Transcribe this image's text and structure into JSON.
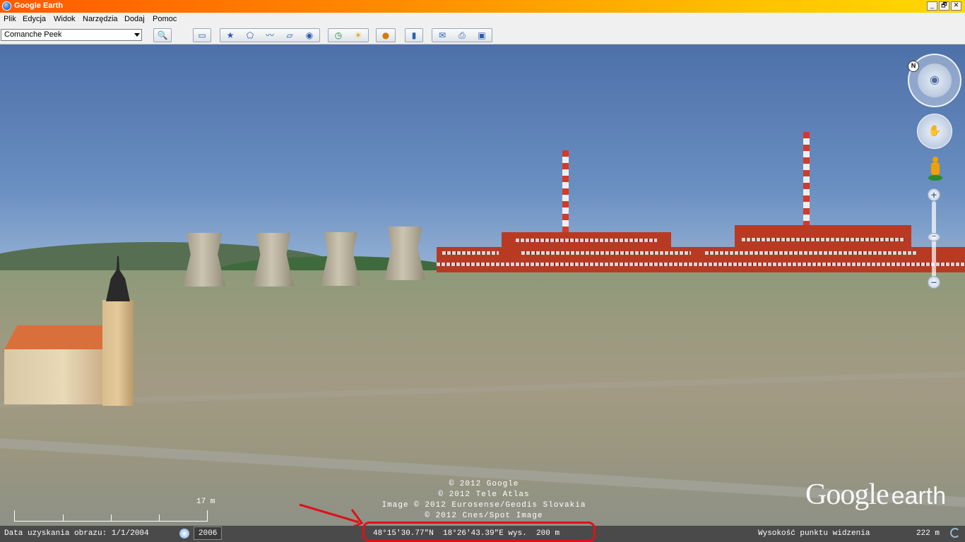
{
  "window": {
    "title": "Google Earth",
    "controls": [
      "_",
      "🗗",
      "✕"
    ]
  },
  "menu": [
    "Plik",
    "Edycja",
    "Widok",
    "Narzędzia",
    "Dodaj",
    "Pomoc"
  ],
  "search": {
    "value": "Comanche Peek"
  },
  "toolbar": {
    "sidebar_icon": "sidebar-icon",
    "group1": [
      "placemark-icon",
      "polygon-icon",
      "path-icon",
      "overlay-icon",
      "tour-icon"
    ],
    "group2": [
      "historical-imagery-icon",
      "sunlight-icon"
    ],
    "planets_icon": "planets-icon",
    "ruler_icon": "ruler-icon",
    "group3": [
      "email-icon",
      "print-icon",
      "save-image-icon"
    ]
  },
  "map": {
    "copyright": [
      "© 2012 Google",
      "© 2012 Tele Atlas",
      "Image © 2012 Eurosense/Geodis Slovakia",
      "© 2012 Cnes/Spot Image"
    ],
    "logo_google": "Google",
    "logo_earth": "earth",
    "scale_label": "17 m"
  },
  "navigation": {
    "north_label": "N",
    "zoom_plus": "+",
    "zoom_minus": "−"
  },
  "status": {
    "imagery_date": "Data uzyskania obrazu: 1/1/2004",
    "year": "2006",
    "coordinates": "48°15'30.77\"N  18°26'43.39\"E wys.  200 m",
    "eye_alt_label": "Wysokość punktu widzenia",
    "eye_alt_value": "222 m"
  },
  "colors": {
    "title_start": "#ff5a00",
    "title_end": "#ffd900",
    "annotation": "#e0101a",
    "roof": "#d9703c",
    "factory": "#b83a22"
  }
}
